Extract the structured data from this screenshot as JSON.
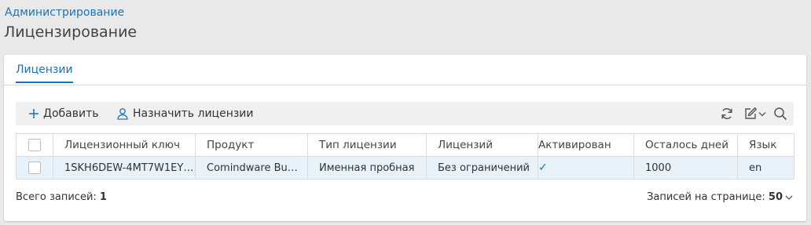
{
  "breadcrumb": "Администрирование",
  "page_title": "Лицензирование",
  "tabs": [
    {
      "label": "Лицензии"
    }
  ],
  "toolbar": {
    "add_label": "Добавить",
    "assign_label": "Назначить лицензии",
    "icons": [
      "plus-icon",
      "user-icon",
      "refresh-icon",
      "edit-icon",
      "chevron-down-icon",
      "search-icon"
    ]
  },
  "table": {
    "columns": [
      "Лицензионный ключ",
      "Продукт",
      "Тип лицензии",
      "Лицензий",
      "Активирован",
      "Осталось дней",
      "Язык"
    ],
    "rows": [
      {
        "key": "1SKH6DEW-4MT7W1EY…",
        "product": "Comindware Bu…",
        "type": "Именная пробная",
        "licenses": "Без ограничений",
        "activated": "✓",
        "days_left": "1000",
        "language": "en"
      }
    ]
  },
  "footer": {
    "total_label": "Всего записей:",
    "total_value": "1",
    "page_size_label": "Записей на странице:",
    "page_size_value": "50"
  },
  "colors": {
    "accent": "#1a73b8",
    "row_highlight": "#e7f2fb"
  }
}
